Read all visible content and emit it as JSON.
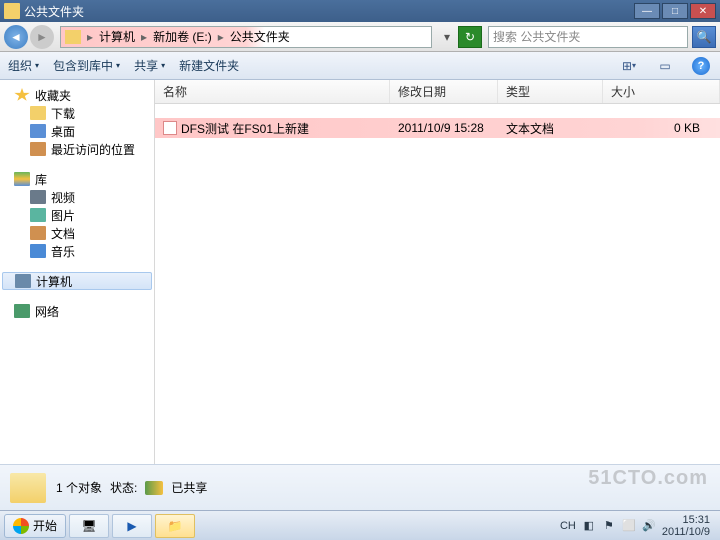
{
  "window": {
    "title": "公共文件夹"
  },
  "winbtns": {
    "min": "—",
    "max": "□",
    "close": "✕"
  },
  "address": {
    "crumbs": [
      "计算机",
      "新加卷 (E:)",
      "公共文件夹"
    ],
    "sep": "▸",
    "dropdown": "▾"
  },
  "nav": {
    "back": "◄",
    "fwd": "►",
    "refresh": "↻"
  },
  "search": {
    "placeholder": "搜索 公共文件夹",
    "icon": "🔍"
  },
  "toolbar": {
    "organize": "组织",
    "include": "包含到库中",
    "share": "共享",
    "newfolder": "新建文件夹",
    "caret": "▾",
    "view": "⊞",
    "preview": "▭",
    "help": "?"
  },
  "columns": {
    "name": "名称",
    "date": "修改日期",
    "type": "类型",
    "size": "大小"
  },
  "files": [
    {
      "name": "DFS测试 在FS01上新建",
      "date": "2011/10/9 15:28",
      "type": "文本文档",
      "size": "0 KB"
    }
  ],
  "sidebar": {
    "favorites": "收藏夹",
    "downloads": "下载",
    "desktop": "桌面",
    "recent": "最近访问的位置",
    "libraries": "库",
    "videos": "视频",
    "pictures": "图片",
    "documents": "文档",
    "music": "音乐",
    "computer": "计算机",
    "network": "网络"
  },
  "status": {
    "objects": "1 个对象",
    "state_label": "状态:",
    "shared": "已共享"
  },
  "watermark": "51CTO.com",
  "taskbar": {
    "start": "开始",
    "lang": "CH",
    "time": "15:31",
    "date": "2011/10/9"
  }
}
